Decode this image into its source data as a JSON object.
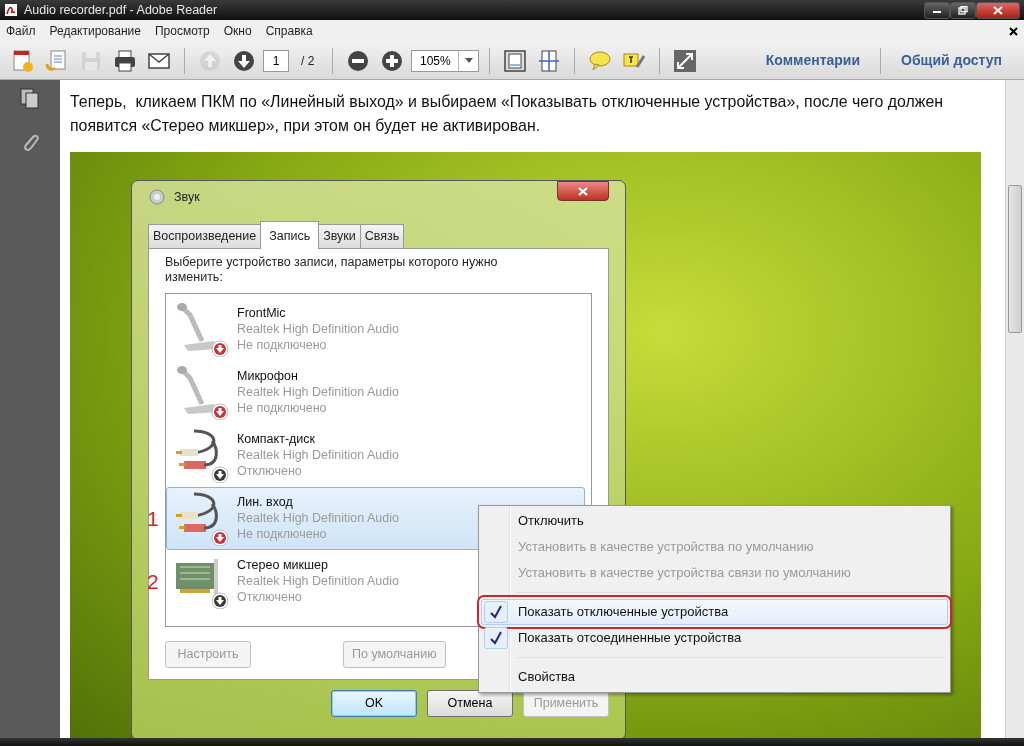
{
  "window": {
    "title": "Audio recorder.pdf - Adobe Reader"
  },
  "menu": [
    "Файл",
    "Редактирование",
    "Просмотр",
    "Окно",
    "Справка"
  ],
  "toolbar": [
    {
      "kind": "create",
      "disabled": false
    },
    {
      "kind": "combine",
      "disabled": false
    },
    {
      "kind": "save",
      "disabled": true
    },
    {
      "kind": "print",
      "disabled": false
    },
    {
      "kind": "email",
      "disabled": false
    },
    {
      "kind": "separator"
    },
    {
      "kind": "up",
      "disabled": true
    },
    {
      "kind": "down",
      "disabled": false
    },
    {
      "kind": "page",
      "value": "1",
      "total": "/ 2"
    },
    {
      "kind": "separator"
    },
    {
      "kind": "zoomout",
      "disabled": false
    },
    {
      "kind": "zoomin",
      "disabled": false
    },
    {
      "kind": "zoom",
      "value": "105%"
    },
    {
      "kind": "separator"
    },
    {
      "kind": "fitpage",
      "disabled": false
    },
    {
      "kind": "fitwidth",
      "disabled": false
    },
    {
      "kind": "separator"
    },
    {
      "kind": "comment",
      "disabled": false
    },
    {
      "kind": "highlight",
      "disabled": false
    },
    {
      "kind": "separator"
    },
    {
      "kind": "fullscreen",
      "disabled": false
    }
  ],
  "panel_links": [
    "Комментарии",
    "Общий доступ"
  ],
  "sidebar": [
    {
      "kind": "pages"
    },
    {
      "kind": "attachments"
    }
  ],
  "document": {
    "paragraph": "Теперь,  кликаем ПКМ по «Линейный выход» и выбираем «Показывать отключенные устройства», после чего должен появится «Стерео микшер», при этом он будет не активирован.",
    "dialog": {
      "title": "Звук",
      "tabs": [
        {
          "label": "Воспроизведение",
          "selected": false
        },
        {
          "label": "Запись",
          "selected": true
        },
        {
          "label": "Звуки",
          "selected": false
        },
        {
          "label": "Связь",
          "selected": false
        }
      ],
      "prompt": "Выберите устройство записи, параметры которого нужно изменить:",
      "devices": [
        {
          "kind": "mic",
          "name": "FrontMic",
          "driver": "Realtek High Definition Audio",
          "status": "Не подключено",
          "unplugged": true,
          "selected": false
        },
        {
          "kind": "mic",
          "name": "Микрофон",
          "driver": "Realtek High Definition Audio",
          "status": "Не подключено",
          "unplugged": true,
          "selected": false
        },
        {
          "kind": "cable",
          "name": "Компакт-диск",
          "driver": "Realtek High Definition Audio",
          "status": "Отключено",
          "unplugged": false,
          "selected": false
        },
        {
          "kind": "cable",
          "name": "Лин. вход",
          "driver": "Realtek High Definition Audio",
          "status": "Не подключено",
          "unplugged": true,
          "selected": true,
          "marker": "1"
        },
        {
          "kind": "card",
          "name": "Стерео микшер",
          "driver": "Realtek High Definition Audio",
          "status": "Отключено",
          "unplugged": false,
          "selected": false,
          "marker": "2"
        }
      ],
      "buttons": [
        {
          "label": "Настроить",
          "disabled": true
        },
        {
          "label": "По умолчанию",
          "disabled": true
        }
      ],
      "footer_buttons": [
        {
          "label": "OK",
          "disabled": false,
          "default": true
        },
        {
          "label": "Отмена",
          "disabled": false,
          "default": false
        },
        {
          "label": "Применить",
          "disabled": true,
          "default": false
        }
      ]
    },
    "context_menu": [
      {
        "kind": "item",
        "label": "Отключить",
        "disabled": false,
        "checked": false,
        "highlighted": false,
        "annotated": false
      },
      {
        "kind": "item",
        "label": "Установить в качестве устройства по умолчанию",
        "disabled": true,
        "checked": false,
        "highlighted": false,
        "annotated": false
      },
      {
        "kind": "item",
        "label": "Установить в качестве устройства связи по умолчанию",
        "disabled": true,
        "checked": false,
        "highlighted": false,
        "annotated": false
      },
      {
        "kind": "separator"
      },
      {
        "kind": "item",
        "label": "Показать отключенные устройства",
        "disabled": false,
        "checked": true,
        "highlighted": true,
        "annotated": true
      },
      {
        "kind": "item",
        "label": "Показать отсоединенные устройства",
        "disabled": false,
        "checked": true,
        "highlighted": false,
        "annotated": false
      },
      {
        "kind": "separator"
      },
      {
        "kind": "item",
        "label": "Свойства",
        "disabled": false,
        "checked": false,
        "highlighted": false,
        "annotated": false
      }
    ]
  }
}
